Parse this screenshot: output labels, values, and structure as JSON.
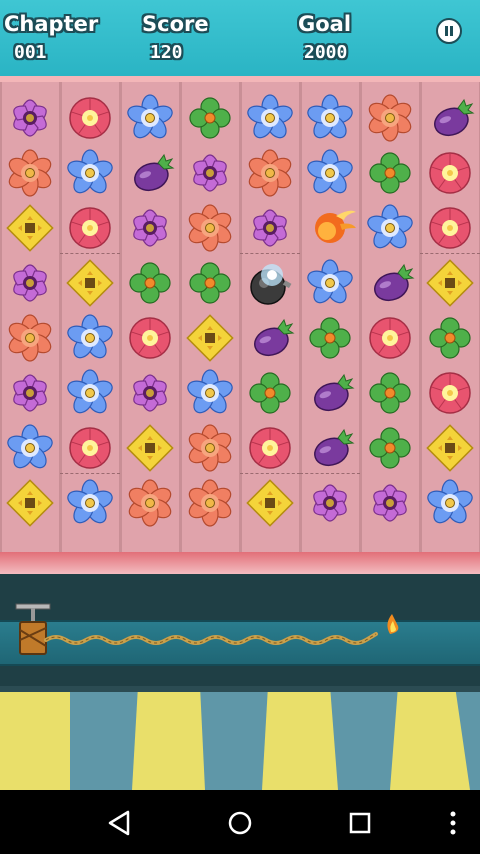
{
  "hud": {
    "chapter_label": "Chapter",
    "chapter_value": "001",
    "score_label": "Score",
    "score_value": "120",
    "goal_label": "Goal",
    "goal_value": "2000"
  },
  "board": {
    "columns": 8,
    "rows": 8,
    "grid": [
      [
        "purple-flower",
        "pink-flower",
        "blue-flower",
        "green-clover",
        "blue-flower",
        "blue-flower",
        "orange-flower",
        "eggplant"
      ],
      [
        "orange-flower",
        "blue-flower",
        "eggplant",
        "purple-flower",
        "orange-flower",
        "blue-flower",
        "green-clover",
        "pink-flower"
      ],
      [
        "yellow-diamond",
        "pink-flower",
        "purple-flower",
        "orange-flower",
        "purple-flower",
        "fireball",
        "blue-flower",
        "pink-flower"
      ],
      [
        "purple-flower",
        "yellow-diamond",
        "green-clover",
        "green-clover",
        "bomb",
        "blue-flower",
        "eggplant",
        "yellow-diamond"
      ],
      [
        "orange-flower",
        "blue-flower",
        "pink-flower",
        "yellow-diamond",
        "eggplant",
        "green-clover",
        "pink-flower",
        "green-clover"
      ],
      [
        "purple-flower",
        "blue-flower",
        "purple-flower",
        "blue-flower",
        "green-clover",
        "eggplant",
        "green-clover",
        "pink-flower"
      ],
      [
        "blue-flower",
        "pink-flower",
        "yellow-diamond",
        "orange-flower",
        "pink-flower",
        "eggplant",
        "green-clover",
        "yellow-diamond"
      ],
      [
        "yellow-diamond",
        "blue-flower",
        "orange-flower",
        "orange-flower",
        "yellow-diamond",
        "purple-flower",
        "purple-flower",
        "blue-flower"
      ]
    ]
  },
  "colors": {
    "hud_bg": "#2ab4c4",
    "board_bg": "#e0a3ab",
    "fuse_track": "#1f6675",
    "stripe_yellow": "#e9df6a",
    "stripe_blue": "#5f97a8"
  },
  "icons": {
    "pause": "pause-icon",
    "nav_back": "back-triangle-icon",
    "nav_home": "home-circle-icon",
    "nav_recents": "recents-square-icon",
    "nav_menu": "overflow-dots-icon"
  }
}
